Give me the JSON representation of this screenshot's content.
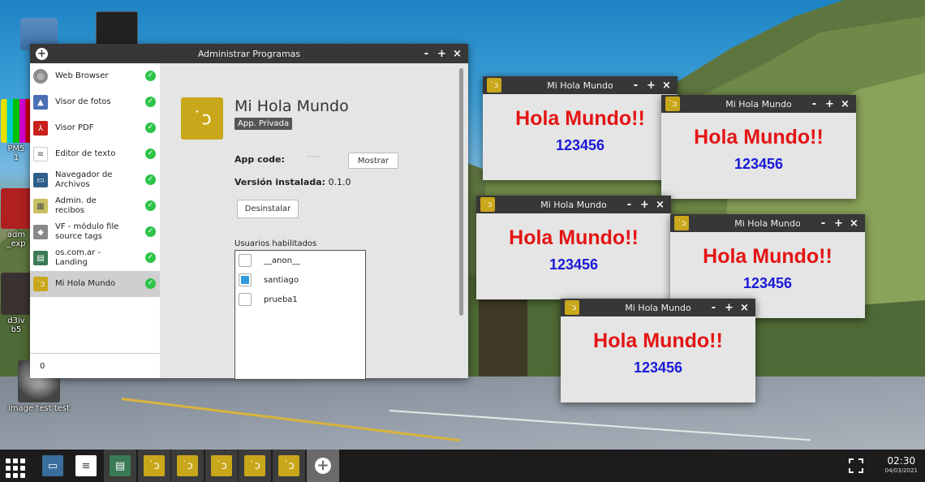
{
  "desktop": {
    "icons": [
      {
        "label": ""
      },
      {
        "label": ""
      },
      {
        "label": "PM5\n1"
      },
      {
        "label": "adm\n_exp"
      },
      {
        "label": "d3iv\nb5"
      },
      {
        "label": "image test test"
      }
    ]
  },
  "main_window": {
    "title": "Administrar Programas",
    "controls": {
      "minimize": "-",
      "maximize": "+",
      "close": "×"
    },
    "sidebar": {
      "items": [
        {
          "label": "Web Browser",
          "icon": "globe-icon",
          "color": "#8c8c8c"
        },
        {
          "label": "Visor de fotos",
          "icon": "photo-icon",
          "color": "#4a6fb5"
        },
        {
          "label": "Visor PDF",
          "icon": "pdf-icon",
          "color": "#c9201c"
        },
        {
          "label": "Editor de texto",
          "icon": "text-editor-icon",
          "color": "#ffffff"
        },
        {
          "label": "Navegador de Archivos",
          "icon": "file-browser-icon",
          "color": "#2f5f8a"
        },
        {
          "label": "Admin. de recibos",
          "icon": "receipt-icon",
          "color": "#c8c060"
        },
        {
          "label": "VF - módulo file source tags",
          "icon": "tag-icon",
          "color": "#888888"
        },
        {
          "label": "os.com.ar - Landing",
          "icon": "landing-icon",
          "color": "#3a7a55"
        },
        {
          "label": "Mi Hola Mundo",
          "icon": "hola-app-icon",
          "color": "#c9a71b"
        }
      ],
      "bottom_value": "0"
    },
    "detail": {
      "app_name": "Mi Hola Mundo",
      "badge": "App. Privada",
      "app_code_label": "App code:",
      "app_code_value": "······",
      "show_button": "Mostrar",
      "version_label": "Versión instalada:",
      "version_value": "0.1.0",
      "uninstall_button": "Desinstalar",
      "users_label": "Usuarios habilitados",
      "users": [
        {
          "name": "__anon__",
          "checked": false
        },
        {
          "name": "santiago",
          "checked": true
        },
        {
          "name": "prueba1",
          "checked": false
        }
      ]
    }
  },
  "hola_windows": [
    {
      "title": "Mi Hola Mundo",
      "heading": "Hola Mundo!!",
      "number": "123456"
    },
    {
      "title": "Mi Hola Mundo",
      "heading": "Hola Mundo!!",
      "number": "123456"
    },
    {
      "title": "Mi Hola Mundo",
      "heading": "Hola Mundo!!",
      "number": "123456"
    },
    {
      "title": "Mi Hola Mundo",
      "heading": "Hola Mundo!!",
      "number": "123456"
    },
    {
      "title": "Mi Hola Mundo",
      "heading": "Hola Mundo!!",
      "number": "123456"
    }
  ],
  "taskbar": {
    "time": "02:30",
    "date": "04/03/2021",
    "items": [
      {
        "icon": "file-browser-icon"
      },
      {
        "icon": "text-editor-icon"
      },
      {
        "icon": "landing-icon"
      },
      {
        "icon": "hola-app-icon"
      },
      {
        "icon": "hola-app-icon"
      },
      {
        "icon": "hola-app-icon"
      },
      {
        "icon": "hola-app-icon"
      },
      {
        "icon": "hola-app-icon"
      },
      {
        "icon": "add-icon"
      }
    ]
  },
  "colors": {
    "titlebar": "#373737",
    "accent_yellow": "#c9a71b",
    "hola_red": "#e41414",
    "hola_blue": "#1a1ad8",
    "check_green": "#2ec44a"
  }
}
